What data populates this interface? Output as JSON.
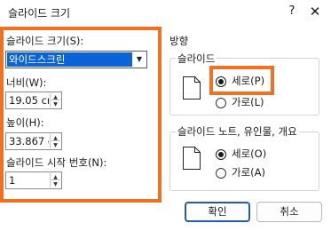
{
  "dialog": {
    "title": "슬라이드 크기",
    "help_label": "?",
    "close_label": "✕"
  },
  "size": {
    "label": "슬라이드 크기(S):",
    "selected": "와이드스크린"
  },
  "width": {
    "label": "너비(W):",
    "value": "19.05 cm"
  },
  "height": {
    "label": "높이(H):",
    "value": "33.867 cm"
  },
  "start_number": {
    "label": "슬라이드 시작 번호(N):",
    "value": "1"
  },
  "orientation": {
    "title": "방향",
    "slides": {
      "title": "슬라이드",
      "portrait": "세로(P)",
      "landscape": "가로(L)"
    },
    "notes": {
      "title": "슬라이드 노트, 유인물, 개요",
      "portrait": "세로(O)",
      "landscape": "가로(A)"
    }
  },
  "buttons": {
    "ok": "확인",
    "cancel": "취소"
  },
  "colors": {
    "highlight": "#f37021",
    "selection": "#0a64d8"
  }
}
